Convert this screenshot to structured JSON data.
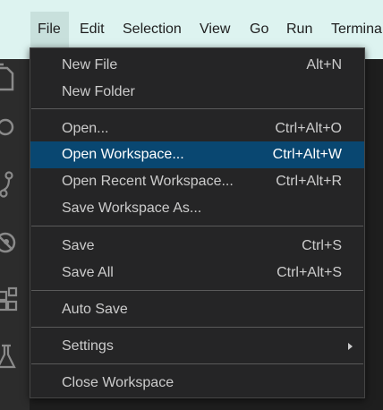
{
  "menubar": {
    "items": [
      {
        "label": "File"
      },
      {
        "label": "Edit"
      },
      {
        "label": "Selection"
      },
      {
        "label": "View"
      },
      {
        "label": "Go"
      },
      {
        "label": "Run"
      },
      {
        "label": "Termina"
      }
    ]
  },
  "activitybar": {
    "icons": [
      "files-icon",
      "search-icon",
      "source-control-icon",
      "debug-icon",
      "extensions-icon",
      "testing-icon"
    ]
  },
  "file_menu": {
    "items": [
      {
        "label": "New File",
        "shortcut": "Alt+N"
      },
      {
        "label": "New Folder",
        "shortcut": ""
      },
      {
        "label": "Open...",
        "shortcut": "Ctrl+Alt+O"
      },
      {
        "label": "Open Workspace...",
        "shortcut": "Ctrl+Alt+W"
      },
      {
        "label": "Open Recent Workspace...",
        "shortcut": "Ctrl+Alt+R"
      },
      {
        "label": "Save Workspace As...",
        "shortcut": ""
      },
      {
        "label": "Save",
        "shortcut": "Ctrl+S"
      },
      {
        "label": "Save All",
        "shortcut": "Ctrl+Alt+S"
      },
      {
        "label": "Auto Save",
        "shortcut": ""
      },
      {
        "label": "Settings",
        "shortcut": ""
      },
      {
        "label": "Close Workspace",
        "shortcut": ""
      }
    ]
  },
  "colors": {
    "highlight": "#094771",
    "menu_bg": "#252526",
    "menubar_bg": "#ddf3f0"
  }
}
